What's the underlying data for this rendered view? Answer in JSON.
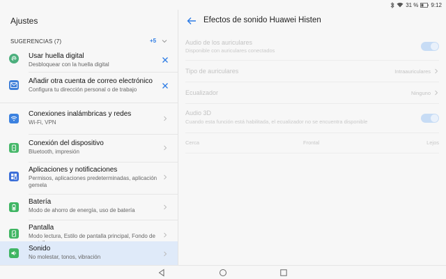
{
  "status": {
    "battery": "31 %",
    "time": "9:12"
  },
  "left": {
    "title": "Ajustes",
    "suggestions": {
      "label": "SUGERENCIAS (7)",
      "more": "+5"
    },
    "suggested_items": [
      {
        "title": "Usar huella digital",
        "subtitle": "Desbloquear con la huella digital",
        "icon": "fingerprint-icon",
        "color": "#4caf7d"
      },
      {
        "title": "Añadir otra cuenta de correo electrónico",
        "subtitle": "Configura tu dirección personal o de trabajo",
        "icon": "mail-icon",
        "color": "#3f7fd8"
      }
    ],
    "items": [
      {
        "title": "Conexiones inalámbricas y redes",
        "subtitle": "Wi-Fi, VPN",
        "icon": "wifi-icon",
        "color": "#3c82e0"
      },
      {
        "title": "Conexión del dispositivo",
        "subtitle": "Bluetooth, impresión",
        "icon": "device-connection-icon",
        "color": "#47b86a"
      },
      {
        "title": "Aplicaciones y notificaciones",
        "subtitle": "Permisos, aplicaciones predeterminadas, aplicación gemela",
        "icon": "apps-icon",
        "color": "#3c6fd8"
      },
      {
        "title": "Batería",
        "subtitle": "Modo de ahorro de energía, uso de batería",
        "icon": "battery-icon",
        "color": "#3fb563"
      },
      {
        "title": "Pantalla",
        "subtitle": "Modo lectura, Estilo de pantalla principal, Fondo de pantalla",
        "icon": "display-icon",
        "color": "#3fb563"
      },
      {
        "title": "Sonido",
        "subtitle": "No molestar, tonos, vibración",
        "icon": "sound-icon",
        "color": "#3fb563"
      }
    ]
  },
  "right": {
    "title": "Efectos de sonido Huawei Histen",
    "headphone_audio": {
      "title": "Audio de los auriculares",
      "subtitle": "Disponible con auriculares conectados"
    },
    "headphone_type": {
      "title": "Tipo de auriculares",
      "value": "Intraauriculares"
    },
    "equalizer": {
      "title": "Ecualizador",
      "value": "Ninguno"
    },
    "audio3d": {
      "title": "Audio 3D",
      "subtitle": "Cuando esta función está habilitada, el ecualizador no se encuentra disponible"
    },
    "slider": {
      "left": "Cerca",
      "center": "Frontal",
      "right": "Lejos"
    }
  }
}
